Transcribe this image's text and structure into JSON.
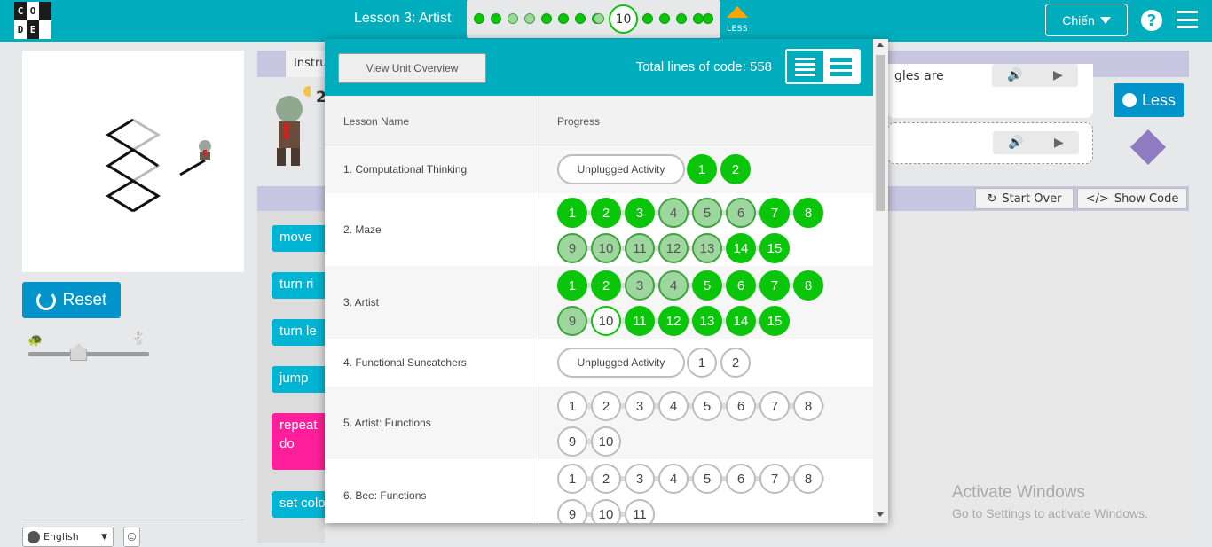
{
  "header": {
    "logo_letters": [
      "C",
      "O",
      "",
      "D",
      "E",
      ""
    ],
    "lesson_title": "Lesson 3: Artist",
    "current_level": "10",
    "less_label": "LESS",
    "user_name": "Chiến",
    "help_icon": "question-circle-icon",
    "menu_icon": "hamburger-icon"
  },
  "left": {
    "reset_label": "Reset",
    "language": "English",
    "copyright_symbol": "©"
  },
  "instructions": {
    "tab_label": "Instru",
    "hint_count": "2",
    "bubble_text": "gles are"
  },
  "right_panel": {
    "less_button": "Less"
  },
  "workspace": {
    "start_over": "Start Over",
    "show_code": "Show Code",
    "blocks": [
      "move",
      "turn ri",
      "turn le",
      "jump",
      "repeat",
      "do",
      "set colo"
    ]
  },
  "watermark": {
    "line1": "Activate Windows",
    "line2": "Go to Settings to activate Windows."
  },
  "popup": {
    "view_unit_overview": "View Unit Overview",
    "total_lines": "Total lines of code: 558",
    "col_lesson": "Lesson Name",
    "col_progress": "Progress",
    "lessons": [
      {
        "name": "1. Computational Thinking",
        "unplugged": "Unplugged Activity",
        "levels": [
          [
            "1",
            "perfect"
          ],
          [
            "2",
            "perfect"
          ]
        ]
      },
      {
        "name": "2. Maze",
        "levels": [
          [
            "1",
            "perfect"
          ],
          [
            "2",
            "perfect"
          ],
          [
            "3",
            "perfect"
          ],
          [
            "4",
            "partial"
          ],
          [
            "5",
            "partial"
          ],
          [
            "6",
            "partial"
          ],
          [
            "7",
            "perfect"
          ],
          [
            "8",
            "perfect"
          ],
          [
            "9",
            "partial"
          ],
          [
            "10",
            "partial"
          ],
          [
            "11",
            "partial"
          ],
          [
            "12",
            "partial"
          ],
          [
            "13",
            "partial"
          ],
          [
            "14",
            "perfect"
          ],
          [
            "15",
            "perfect"
          ]
        ]
      },
      {
        "name": "3. Artist",
        "levels": [
          [
            "1",
            "perfect"
          ],
          [
            "2",
            "perfect"
          ],
          [
            "3",
            "partial"
          ],
          [
            "4",
            "partial"
          ],
          [
            "5",
            "perfect"
          ],
          [
            "6",
            "perfect"
          ],
          [
            "7",
            "perfect"
          ],
          [
            "8",
            "perfect"
          ],
          [
            "9",
            "partial"
          ],
          [
            "10",
            "current"
          ],
          [
            "11",
            "perfect"
          ],
          [
            "12",
            "perfect"
          ],
          [
            "13",
            "perfect"
          ],
          [
            "14",
            "perfect"
          ],
          [
            "15",
            "perfect"
          ]
        ]
      },
      {
        "name": "4. Functional Suncatchers",
        "unplugged": "Unplugged Activity",
        "levels": [
          [
            "1",
            "todo"
          ],
          [
            "2",
            "todo"
          ]
        ]
      },
      {
        "name": "5. Artist: Functions",
        "levels": [
          [
            "1",
            "todo"
          ],
          [
            "2",
            "todo"
          ],
          [
            "3",
            "todo"
          ],
          [
            "4",
            "todo"
          ],
          [
            "5",
            "todo"
          ],
          [
            "6",
            "todo"
          ],
          [
            "7",
            "todo"
          ],
          [
            "8",
            "todo"
          ],
          [
            "9",
            "todo"
          ],
          [
            "10",
            "todo"
          ]
        ]
      },
      {
        "name": "6. Bee: Functions",
        "levels": [
          [
            "1",
            "todo"
          ],
          [
            "2",
            "todo"
          ],
          [
            "3",
            "todo"
          ],
          [
            "4",
            "todo"
          ],
          [
            "5",
            "todo"
          ],
          [
            "6",
            "todo"
          ],
          [
            "7",
            "todo"
          ],
          [
            "8",
            "todo"
          ],
          [
            "9",
            "todo"
          ],
          [
            "10",
            "todo"
          ],
          [
            "11",
            "todo"
          ]
        ]
      }
    ]
  },
  "colors": {
    "header_teal": "#00adbc",
    "perfect_green": "#0ac50a",
    "partial_green": "#9dd79d",
    "button_blue": "#0094ca",
    "repeat_pink": "#ff1f9a",
    "block_cyan": "#00b4d3"
  }
}
